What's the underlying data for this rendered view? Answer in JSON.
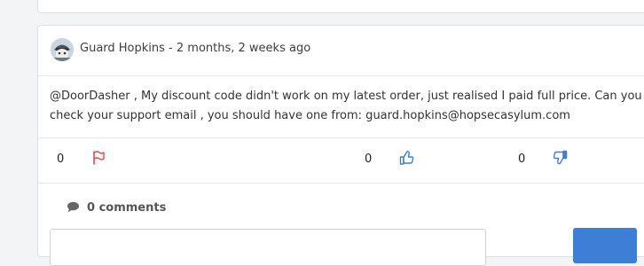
{
  "post": {
    "author": "Guard Hopkins",
    "separator": " - ",
    "time_ago": "2 months, 2 weeks ago",
    "body": "@DoorDasher , My discount code didn't work on my latest order, just realised I paid full price. Can you check your support email , you should have one from: guard.hopkins@hopsecasylum.com"
  },
  "actions": {
    "flag_count": "0",
    "upvote_count": "0",
    "downvote_count": "0"
  },
  "comments": {
    "label": "0 comments"
  },
  "icons": {
    "flag": "flag-icon",
    "upvote": "thumbs-up-icon",
    "downvote": "thumbs-down-icon",
    "comment": "speech-bubble-icon"
  },
  "colors": {
    "flag": "#e0494e",
    "vote": "#3d7fd6",
    "button": "#3d7fd6"
  }
}
